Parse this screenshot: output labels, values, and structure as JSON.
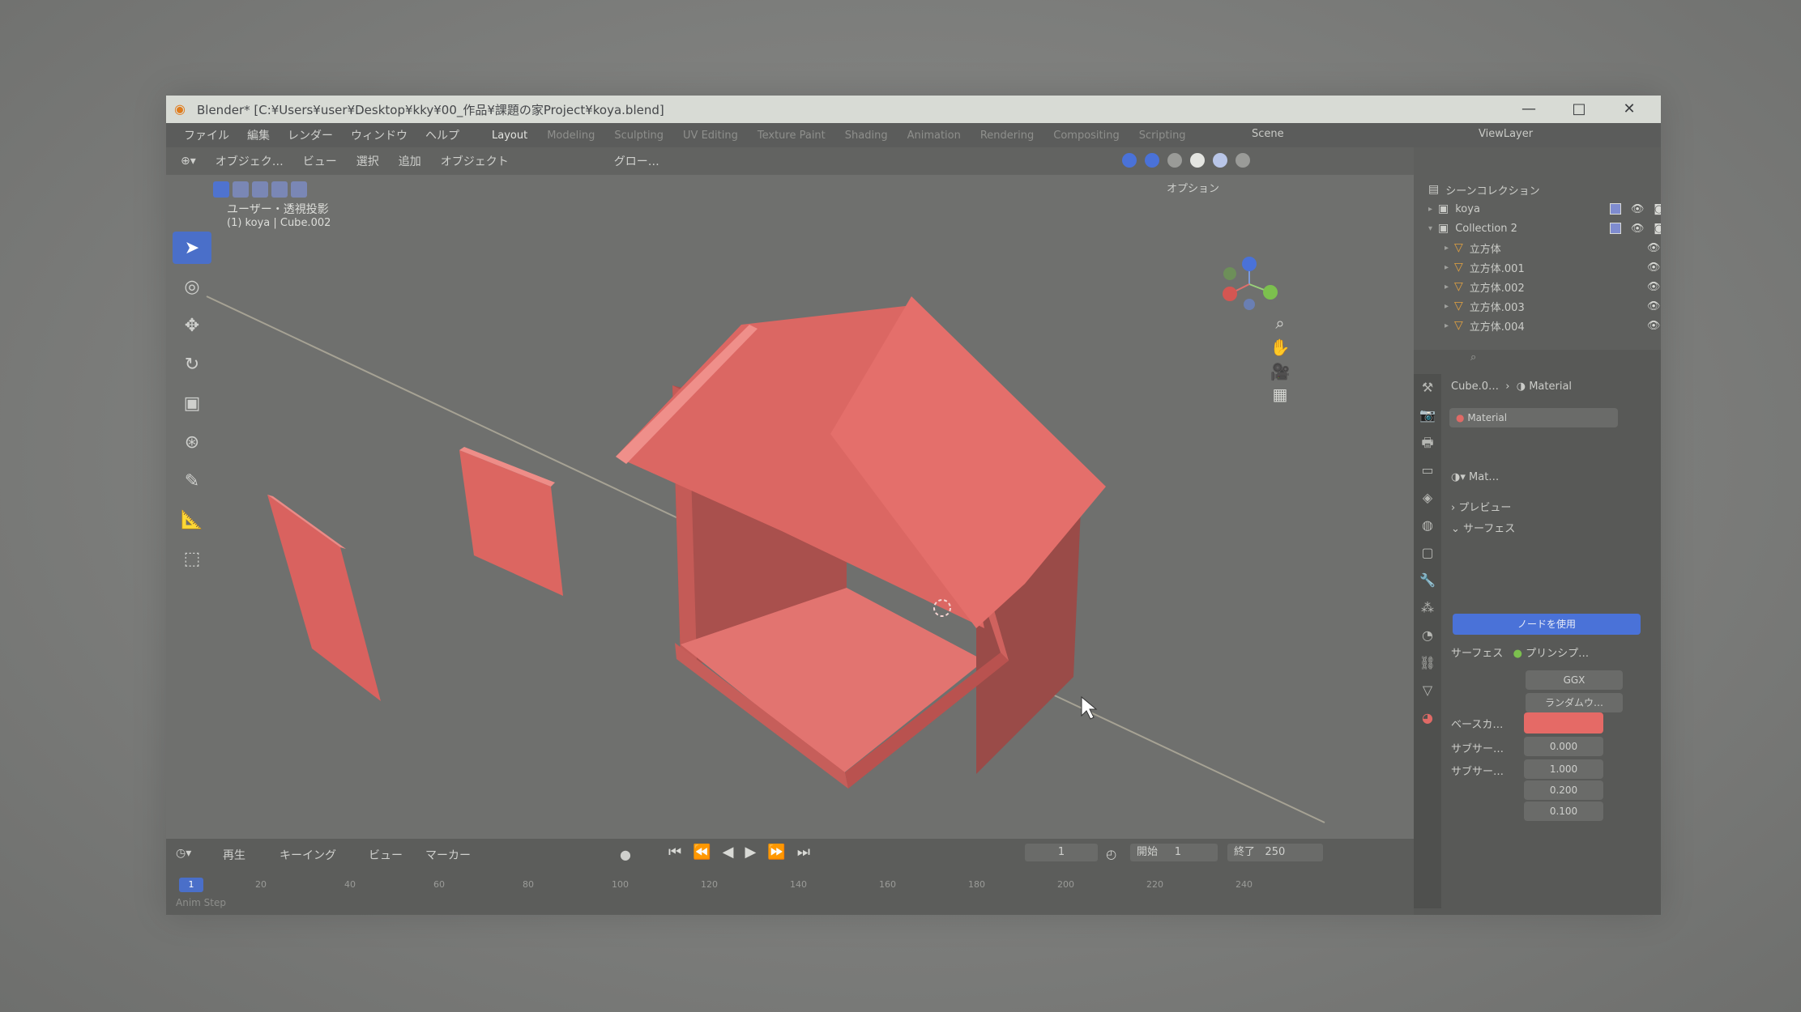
{
  "window": {
    "title": "Blender* [C:¥Users¥user¥Desktop¥kky¥00_作品¥課題の家Project¥koya.blend]",
    "controls": [
      "—",
      "□",
      "✕"
    ]
  },
  "top_menu": {
    "items": [
      "ファイル",
      "編集",
      "レンダー",
      "ウィンドウ",
      "ヘルプ"
    ],
    "workspaces": [
      "Layout",
      "Modeling",
      "Sculpting",
      "UV Editing",
      "Texture Paint",
      "Shading",
      "Animation",
      "Rendering",
      "Compositing",
      "Scripting"
    ],
    "active_workspace": "Layout",
    "scene": "Scene",
    "view_layer": "ViewLayer"
  },
  "viewport_header": {
    "mode": "オブジェク…",
    "items": [
      "ビュー",
      "選択",
      "追加",
      "オブジェクト"
    ],
    "transform": "グロー…",
    "options": "オプション"
  },
  "viewport": {
    "view_name": "ユーザー・透視投影",
    "object_info": "(1) koya | Cube.002",
    "house_color": "#e06a66",
    "tools": [
      "select-box-icon",
      "cursor-icon",
      "move-icon",
      "rotate-icon",
      "scale-icon",
      "transform-icon",
      "annotate-icon",
      "measure-icon",
      "add-cube-icon"
    ]
  },
  "timeline": {
    "items": [
      "再生",
      "キーイング",
      "ビュー",
      "マーカー"
    ],
    "current_frame": "1",
    "start_label": "開始",
    "start": "1",
    "end_label": "終了",
    "end": "250",
    "ruler_ticks": [
      "1",
      "20",
      "40",
      "60",
      "80",
      "100",
      "120",
      "140",
      "160",
      "180",
      "200",
      "220",
      "240"
    ],
    "ruler_current": "1",
    "status": "Anim Step"
  },
  "outliner": {
    "header": "シーンコレクション",
    "rows": [
      {
        "name": "koya",
        "level": 1
      },
      {
        "name": "Collection 2",
        "level": 1
      },
      {
        "name": "立方体",
        "level": 2
      },
      {
        "name": "立方体.001",
        "level": 2
      },
      {
        "name": "立方体.002",
        "level": 2
      },
      {
        "name": "立方体.003",
        "level": 2
      },
      {
        "name": "立方体.004",
        "level": 2
      }
    ]
  },
  "properties": {
    "breadcrumb_object": "Cube.0…",
    "breadcrumb_material": "Material",
    "material_slot": "Material",
    "material_short": "Mat…",
    "sections": {
      "preview": "プレビュー",
      "surface": "サーフェス"
    },
    "use_nodes_button": "ノードを使用",
    "surface_label": "サーフェス",
    "surface_value": "プリンシプ…",
    "distribution": "GGX",
    "subsurface_method": "ランダムウ…",
    "rows": [
      {
        "label": "ベースカ…",
        "value": ""
      },
      {
        "label": "サブサー…",
        "value": "0.000"
      },
      {
        "label": "サブサー…",
        "value": "1.000"
      },
      {
        "label": "",
        "value": "0.200"
      },
      {
        "label": "",
        "value": "0.100"
      }
    ],
    "base_color": "#e56a66"
  },
  "colors": {
    "accent_blue": "#4a72d8",
    "house": "#e06a66",
    "titlebar": "#d8dbd5"
  }
}
